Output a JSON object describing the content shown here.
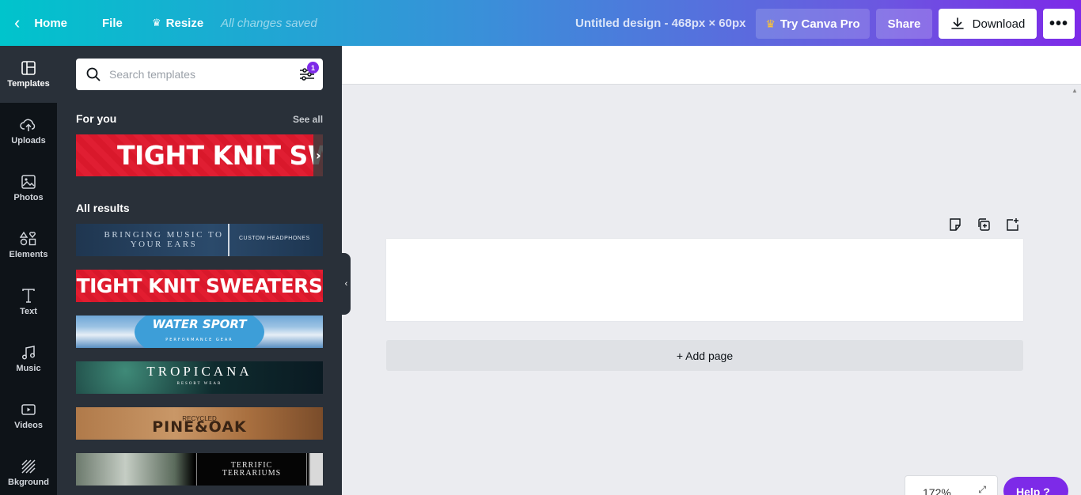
{
  "topbar": {
    "home_label": "Home",
    "file_label": "File",
    "resize_label": "Resize",
    "saved_status": "All changes saved",
    "design_title": "Untitled design - 468px × 60px",
    "try_pro_label": "Try Canva Pro",
    "share_label": "Share",
    "download_label": "Download",
    "more_label": "•••"
  },
  "rail": {
    "items": [
      {
        "label": "Templates",
        "icon": "layout-icon"
      },
      {
        "label": "Uploads",
        "icon": "cloud-upload-icon"
      },
      {
        "label": "Photos",
        "icon": "image-icon"
      },
      {
        "label": "Elements",
        "icon": "shapes-icon"
      },
      {
        "label": "Text",
        "icon": "text-icon"
      },
      {
        "label": "Music",
        "icon": "music-note-icon"
      },
      {
        "label": "Videos",
        "icon": "video-icon"
      },
      {
        "label": "Bkground",
        "icon": "background-pattern-icon"
      }
    ]
  },
  "panel": {
    "search_placeholder": "Search templates",
    "filter_badge": "1",
    "for_you_title": "For you",
    "see_all_label": "See all",
    "all_results_title": "All results",
    "templates": {
      "featured": "TIGHT KNIT SWEAT",
      "music_main": "BRINGING MUSIC TO YOUR EARS",
      "music_side": "CUSTOM HEADPHONES",
      "knit": "TIGHT KNIT SWEATERS",
      "water": "WATER SPORT",
      "water_sub": "PERFORMANCE GEAR",
      "tropicana": "TROPICANA",
      "tropicana_sub": "RESORT WEAR",
      "pine_small": "RECYCLED",
      "pine_big": "PINE&OAK",
      "terrarium_1": "TERRIFIC",
      "terrarium_2": "TERRARIUMS"
    }
  },
  "canvas": {
    "add_page_label": "+ Add page",
    "zoom_level": "172%",
    "help_label": "Help ?"
  },
  "colors": {
    "accent_purple": "#7d2ae8",
    "teal": "#00c4cc",
    "rail_bg": "#0e1318",
    "panel_bg": "#293039"
  }
}
